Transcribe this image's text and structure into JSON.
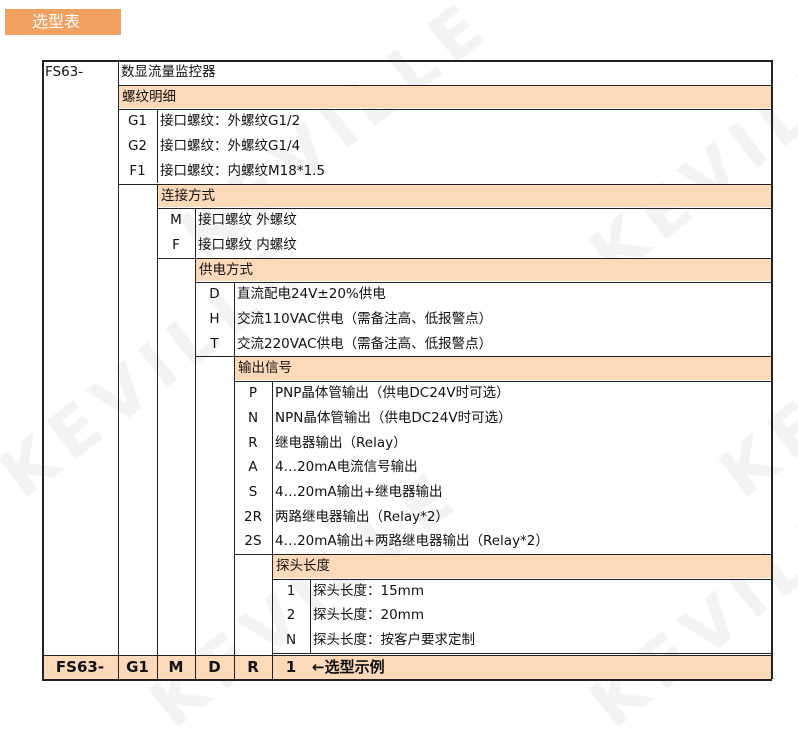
{
  "section_title": "选型表",
  "watermark": "KEVILLE",
  "colors": {
    "header_band": "#fbd9b9",
    "title_badge": "#f0a15f",
    "summary_row": "#fbd9b9"
  },
  "table": {
    "model_code": "FS63-",
    "model_name": "数显流量监控器",
    "groups": [
      {
        "heading": "螺纹明细",
        "options": [
          {
            "code": "G1",
            "desc": "接口螺纹：外螺纹G1/2"
          },
          {
            "code": "G2",
            "desc": "接口螺纹：外螺纹G1/4"
          },
          {
            "code": "F1",
            "desc": "接口螺纹：内螺纹M18*1.5"
          }
        ]
      },
      {
        "heading": "连接方式",
        "options": [
          {
            "code": "M",
            "desc": "接口螺纹  外螺纹"
          },
          {
            "code": "F",
            "desc": "接口螺纹  内螺纹"
          }
        ]
      },
      {
        "heading": "供电方式",
        "options": [
          {
            "code": "D",
            "desc": "直流配电24V±20%供电"
          },
          {
            "code": "H",
            "desc": "交流110VAC供电（需备注高、低报警点）"
          },
          {
            "code": "T",
            "desc": "交流220VAC供电（需备注高、低报警点）"
          }
        ]
      },
      {
        "heading": "输出信号",
        "options": [
          {
            "code": "P",
            "desc": "PNP晶体管输出（供电DC24V时可选）"
          },
          {
            "code": "N",
            "desc": "NPN晶体管输出（供电DC24V时可选）"
          },
          {
            "code": "R",
            "desc": "继电器输出（Relay）"
          },
          {
            "code": "A",
            "desc": "4…20mA电流信号输出"
          },
          {
            "code": "S",
            "desc": "4…20mA输出+继电器输出"
          },
          {
            "code": "2R",
            "desc": "两路继电器输出（Relay*2）"
          },
          {
            "code": "2S",
            "desc": "4…20mA输出+两路继电器输出（Relay*2）"
          }
        ]
      },
      {
        "heading": "探头长度",
        "options": [
          {
            "code": "1",
            "desc": "探头长度：15mm"
          },
          {
            "code": "2",
            "desc": "探头长度：20mm"
          },
          {
            "code": "N",
            "desc": "探头长度：按客户要求定制"
          }
        ]
      }
    ],
    "example": {
      "codes": [
        "FS63-",
        "G1",
        "M",
        "D",
        "R",
        "1"
      ],
      "label": "←选型示例"
    }
  }
}
